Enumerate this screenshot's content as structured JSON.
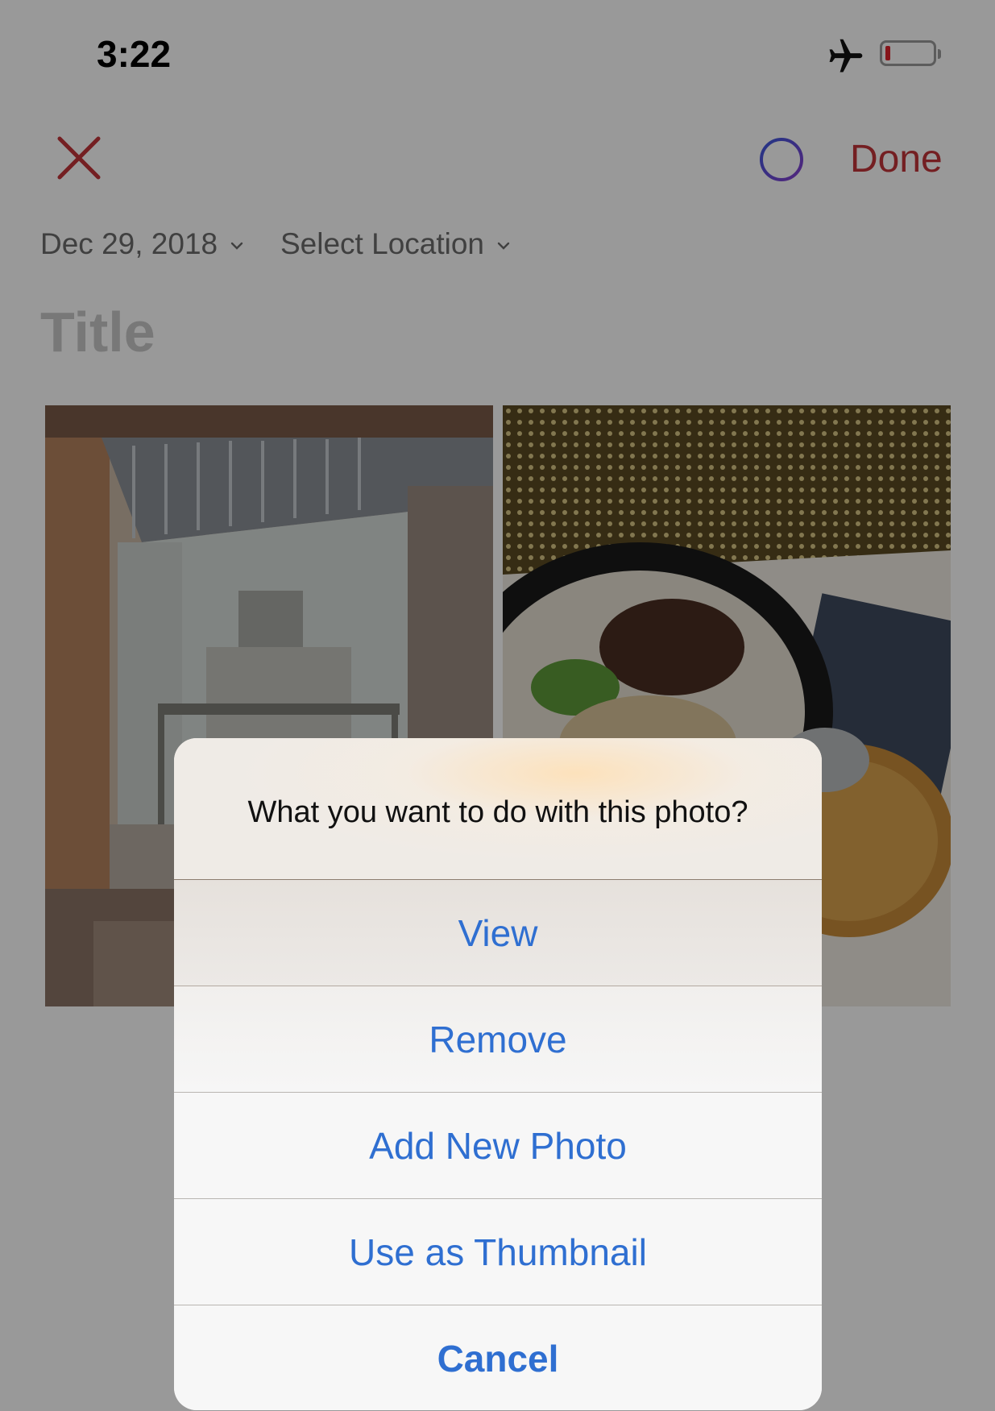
{
  "status_bar": {
    "time": "3:22",
    "airplane_icon": "airplane-icon",
    "battery_icon": "battery-low-icon"
  },
  "nav": {
    "close_icon": "close-x-icon",
    "status_icon": "ring-icon",
    "done_label": "Done"
  },
  "entry": {
    "date": "Dec 29, 2018",
    "location": "Select Location",
    "title_placeholder": "Title"
  },
  "photos": [
    {
      "name": "photo-workshop"
    },
    {
      "name": "photo-ramen"
    }
  ],
  "alert": {
    "message": "What you want to do with this photo?",
    "actions": [
      {
        "label": "View"
      },
      {
        "label": "Remove"
      },
      {
        "label": "Add New Photo"
      },
      {
        "label": "Use as Thumbnail"
      }
    ],
    "cancel_label": "Cancel"
  },
  "colors": {
    "accent_red": "#c1343a",
    "action_blue": "#2f6fd1",
    "ring_purple": "#6a3fd8"
  }
}
